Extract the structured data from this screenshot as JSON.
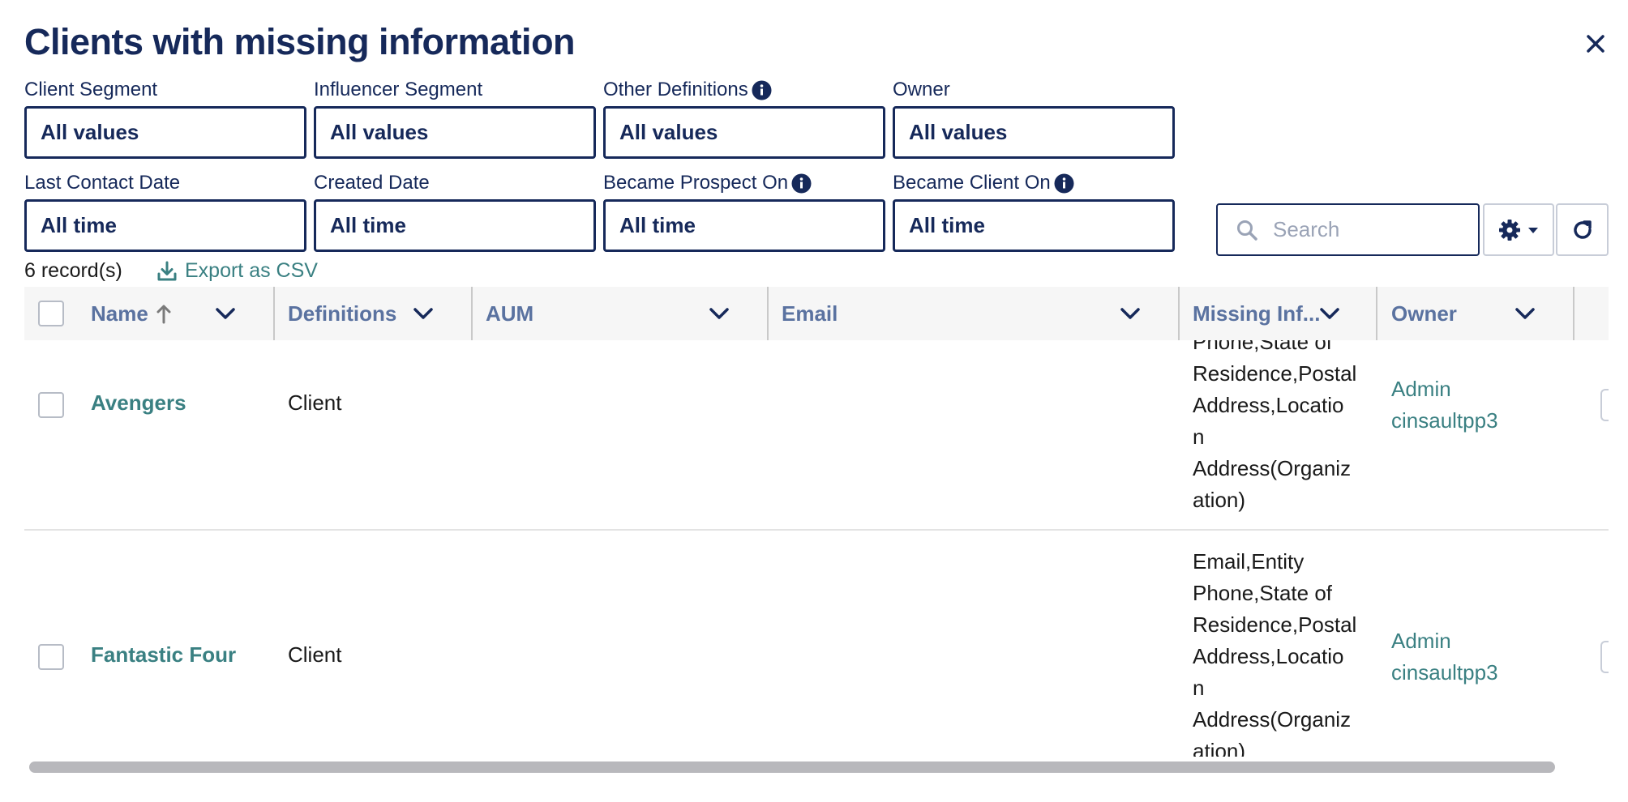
{
  "title": "Clients with missing information",
  "filters": {
    "row1": [
      {
        "label": "Client Segment",
        "value": "All values",
        "info": false
      },
      {
        "label": "Influencer Segment",
        "value": "All values",
        "info": false
      },
      {
        "label": "Other Definitions",
        "value": "All values",
        "info": true
      },
      {
        "label": "Owner",
        "value": "All values",
        "info": false
      }
    ],
    "row2": [
      {
        "label": "Last Contact Date",
        "value": "All time",
        "info": false
      },
      {
        "label": "Created Date",
        "value": "All time",
        "info": false
      },
      {
        "label": "Became Prospect On",
        "value": "All time",
        "info": true
      },
      {
        "label": "Became Client On",
        "value": "All time",
        "info": true
      }
    ]
  },
  "search": {
    "placeholder": "Search",
    "value": ""
  },
  "records_count": "6 record(s)",
  "export_label": "Export as CSV",
  "columns": {
    "name": "Name",
    "definitions": "Definitions",
    "aum": "AUM",
    "email": "Email",
    "missing": "Missing Inf...",
    "owner": "Owner"
  },
  "rows": [
    {
      "name": "Avengers",
      "definitions": "Client",
      "missing_lines": [
        "Phone,State of",
        "Residence,Postal",
        "Address,Locatio",
        "n",
        "Address(Organiz",
        "ation)"
      ],
      "owner_lines": [
        "Admin",
        "cinsaultpp3"
      ]
    },
    {
      "name": "Fantastic Four",
      "definitions": "Client",
      "missing_lines": [
        "Email,Entity",
        "Phone,State of",
        "Residence,Postal",
        "Address,Locatio",
        "n",
        "Address(Organiz",
        "ation)"
      ],
      "owner_lines": [
        "Admin",
        "cinsaultpp3"
      ]
    }
  ],
  "colors": {
    "primary": "#16295a",
    "link": "#3a8082",
    "header_text": "#5a72a0"
  },
  "icons": [
    "close-icon",
    "info-icon",
    "search-icon",
    "gear-icon",
    "caret-down-icon",
    "refresh-icon",
    "download-icon",
    "chevron-down-icon",
    "sort-arrow-up-icon"
  ]
}
